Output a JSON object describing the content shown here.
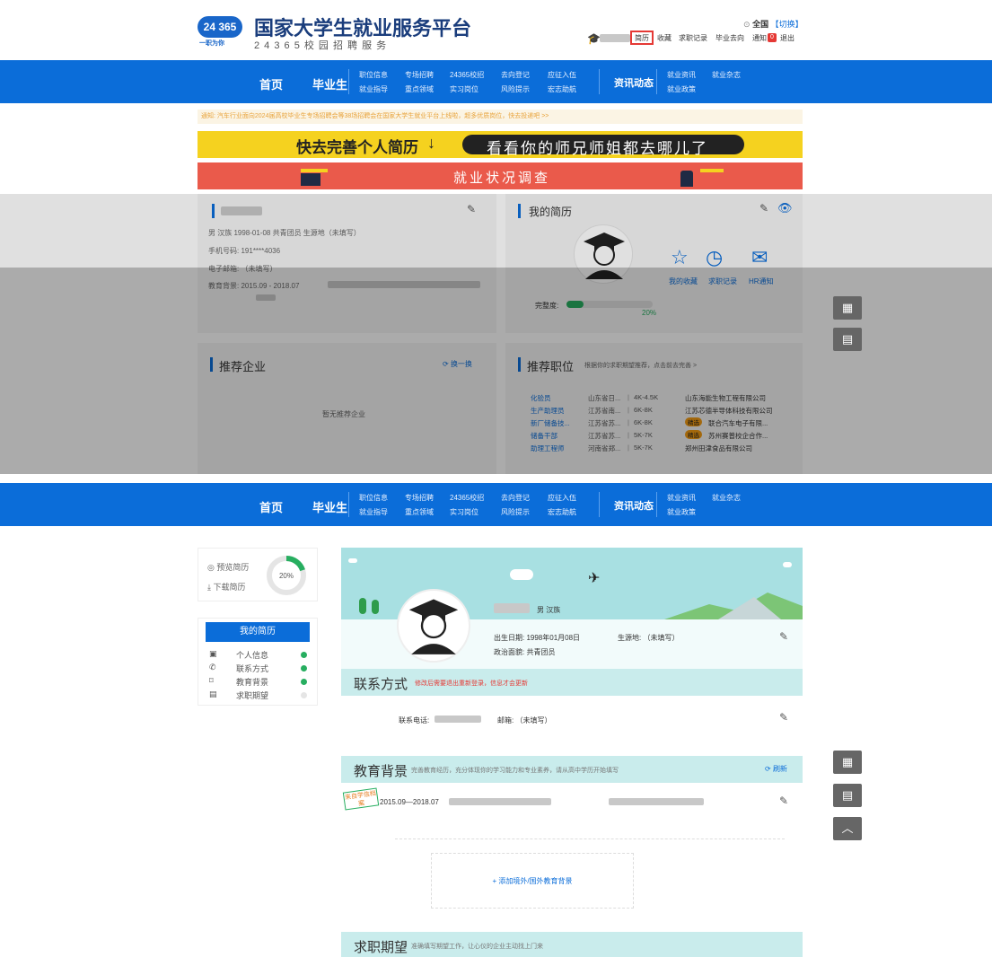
{
  "brand": {
    "badge": "24 365",
    "tagline": "一职为你",
    "title": "国家大学生就业服务平台",
    "subtitle": "2 4 3 6 5 校 园 招 聘 服 务"
  },
  "header": {
    "location": "全国",
    "switch": "【切换】",
    "links": [
      "简历",
      "收藏",
      "求职记录",
      "毕业去向",
      "通知",
      "退出"
    ],
    "notify_count": "0"
  },
  "nav": {
    "home": "首页",
    "grad": "毕业生",
    "items_top": [
      "职位信息",
      "专场招聘",
      "24365校招",
      "去向登记",
      "应征入伍"
    ],
    "items_bottom": [
      "就业指导",
      "重点领域",
      "实习岗位",
      "风险提示",
      "宏志助航"
    ],
    "news": "资讯动态",
    "news_top": [
      "就业资讯",
      "就业杂志"
    ],
    "news_bottom": [
      "就业政策"
    ]
  },
  "notice": "通知: 汽车行业面向2024届高校毕业生专场招聘会等38场招聘会在国家大学生就业平台上线啦，超多优质岗位，快去投递吧 >>",
  "banner1": {
    "left": "快去完善个人简历",
    "arrow": "↓",
    "right": "看看你的师兄师姐都去哪儿了"
  },
  "banner2": {
    "text": "就业状况调查"
  },
  "profile": {
    "info": "男  汉族  1998-01-08  共青团员  生源地（未填写）",
    "phone_label": "手机号码:",
    "phone": "191****4036",
    "email": "电子邮箱:  （未填写）",
    "edu_label": "教育背景:",
    "edu": "2015.09 - 2018.07"
  },
  "resume": {
    "title": "我的简历",
    "completion_label": "完整度:",
    "completion_pct": "20%",
    "completion_frac": 0.2,
    "favorites": "我的收藏",
    "records": "求职记录",
    "hr": "HR通知"
  },
  "rec_company": {
    "title": "推荐企业",
    "refresh": "换一换",
    "empty": "暂无推荐企业"
  },
  "rec_jobs": {
    "title": "推荐职位",
    "hint": "根据你的求职期望推荐，点击前去完善 >",
    "badge": "精选",
    "rows": [
      {
        "job": "化验员",
        "loc": "山东省日...",
        "salary": "4K-4.5K",
        "company": "山东海能生物工程有限公司",
        "featured": false
      },
      {
        "job": "生产助理员",
        "loc": "江苏省南...",
        "salary": "6K-8K",
        "company": "江苏芯德半导体科技有限公司",
        "featured": false
      },
      {
        "job": "新厂储备技...",
        "loc": "江苏省苏...",
        "salary": "6K-8K",
        "company": "联合汽车电子有限...",
        "featured": true
      },
      {
        "job": "储备干部",
        "loc": "江苏省苏...",
        "salary": "5K-7K",
        "company": "苏州赛普校企合作...",
        "featured": true
      },
      {
        "job": "助理工程师",
        "loc": "河南省郑...",
        "salary": "5K-7K",
        "company": "郑州田津食品有限公司",
        "featured": false
      }
    ]
  },
  "sidebar": {
    "preview": "预览简历",
    "download": "下载简历",
    "pct": "20%",
    "pct_frac": 0.2,
    "title": "我的简历",
    "items": [
      {
        "label": "个人信息",
        "done": true
      },
      {
        "label": "联系方式",
        "done": true
      },
      {
        "label": "教育背景",
        "done": true
      },
      {
        "label": "求职期望",
        "done": false
      }
    ]
  },
  "detail": {
    "gender_ethnic": "男    汉族",
    "birth": "出生日期: 1998年01月08日",
    "origin": "生源地: （未填写）",
    "politics": "政治面貌: 共青团员"
  },
  "contact": {
    "title": "联系方式",
    "note": "修改后需要退出重新登录，信息才会更新",
    "phone_label": "联系电话:",
    "email": "邮箱: （未填写）"
  },
  "education": {
    "title": "教育背景",
    "note": "完善教育经历，充分体现你的学习能力和专业素养，请从高中学历开始填写",
    "refresh": "刷新",
    "stamp": "来自学信档案",
    "dates": "2015.09—2018.07",
    "add": "+ 添加境外/国外教育背景"
  },
  "expect": {
    "title": "求职期望",
    "note": "准确填写期望工作，让心仪的企业主动找上门来"
  },
  "colors": {
    "primary": "#0b6dd9",
    "banner_yellow": "#f5d21f",
    "banner_red": "#ea5a4b",
    "teal": "#c9ecec",
    "green": "#27ae60",
    "orange": "#f39c12"
  }
}
